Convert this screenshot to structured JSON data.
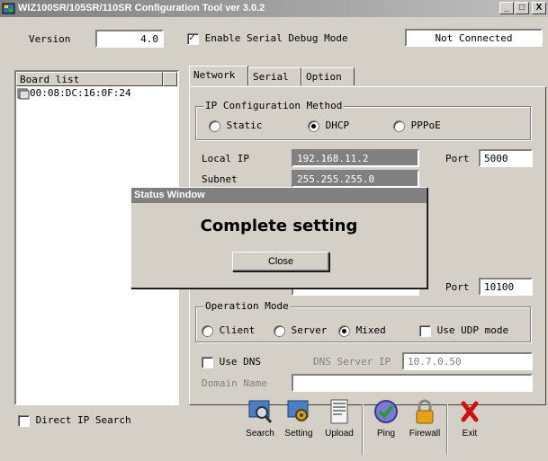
{
  "window": {
    "title": "WIZ100SR/105SR/110SR Configuration Tool ver 3.0.2",
    "minimize": "_",
    "maximize": "□",
    "close": "X"
  },
  "header": {
    "version_label": "Version",
    "version_value": "4.0",
    "debug_label": "Enable Serial Debug Mode",
    "debug_checked": true,
    "connection_status": "Not Connected"
  },
  "board_list": {
    "header": "Board list",
    "items": [
      "00:08:DC:16:0F:24"
    ]
  },
  "tabs": [
    {
      "label": "Network",
      "active": true
    },
    {
      "label": "Serial",
      "active": false
    },
    {
      "label": "Option",
      "active": false
    }
  ],
  "ip_config": {
    "legend": "IP Configuration Method",
    "options": [
      "Static",
      "DHCP",
      "PPPoE"
    ],
    "selected": "DHCP"
  },
  "network": {
    "local_ip_label": "Local IP",
    "local_ip": "192.168.11.2",
    "port_label": "Port",
    "local_port": "5000",
    "subnet_label": "Subnet",
    "subnet": "255.255.255.0",
    "server_port": "10100"
  },
  "operation_mode": {
    "legend": "Operation Mode",
    "options": [
      "Client",
      "Server",
      "Mixed"
    ],
    "selected": "Mixed",
    "udp_label": "Use UDP mode"
  },
  "dns": {
    "use_dns_label": "Use DNS",
    "server_ip_label": "DNS Server IP",
    "server_ip": "10.7.0.50",
    "domain_label": "Domain Name",
    "domain_value": ""
  },
  "direct_ip_label": "Direct IP Search",
  "toolbar": {
    "search": "Search",
    "setting": "Setting",
    "upload": "Upload",
    "ping": "Ping",
    "firewall": "Firewall",
    "exit": "Exit"
  },
  "dialog": {
    "title": "Status Window",
    "message": "Complete setting",
    "close_label": "Close"
  },
  "colors": {
    "face": "#d4d0c8",
    "titlebar_inactive": "#808080",
    "exit_red": "#cc1111"
  }
}
